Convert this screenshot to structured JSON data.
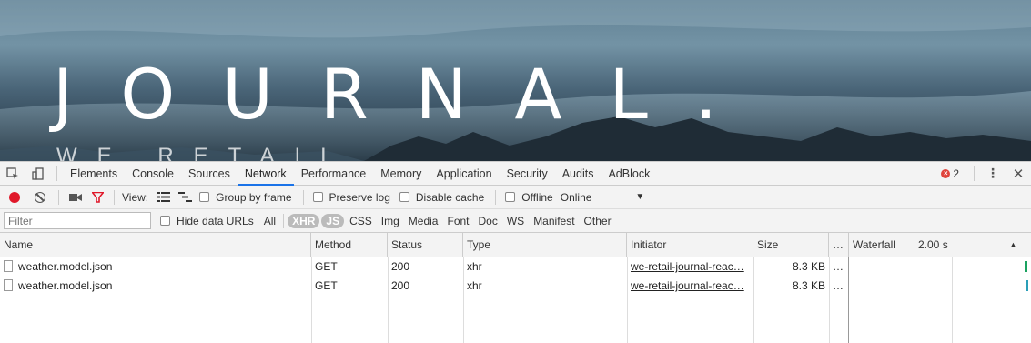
{
  "hero": {
    "title": "JOURNAL.",
    "subtitle": "WE RETAIL"
  },
  "devtools": {
    "tabs": [
      "Elements",
      "Console",
      "Sources",
      "Network",
      "Performance",
      "Memory",
      "Application",
      "Security",
      "Audits",
      "AdBlock"
    ],
    "active_tab": "Network",
    "error_count": "2"
  },
  "toolbar": {
    "view_label": "View:",
    "group_by_frame": "Group by frame",
    "preserve_log": "Preserve log",
    "disable_cache": "Disable cache",
    "offline": "Offline",
    "throttle_value": "Online"
  },
  "filter": {
    "placeholder": "Filter",
    "hide_data_urls": "Hide data URLs",
    "types": [
      "All",
      "XHR",
      "JS",
      "CSS",
      "Img",
      "Media",
      "Font",
      "Doc",
      "WS",
      "Manifest",
      "Other"
    ],
    "selected_types": [
      "XHR",
      "JS"
    ]
  },
  "table": {
    "columns": [
      "Name",
      "Method",
      "Status",
      "Type",
      "Initiator",
      "Size",
      "…",
      "Waterfall"
    ],
    "waterfall_time": "2.00 s",
    "rows": [
      {
        "name": "weather.model.json",
        "method": "GET",
        "status": "200",
        "type": "xhr",
        "initiator": "we-retail-journal-reac…",
        "size": "8.3 KB",
        "more": "…"
      },
      {
        "name": "weather.model.json",
        "method": "GET",
        "status": "200",
        "type": "xhr",
        "initiator": "we-retail-journal-reac…",
        "size": "8.3 KB",
        "more": "…"
      }
    ]
  },
  "colors": {
    "record": "#e0182a",
    "active_tab_underline": "#1a73e8",
    "waterfall_bar": "#1aa260",
    "error": "#e0443c"
  }
}
